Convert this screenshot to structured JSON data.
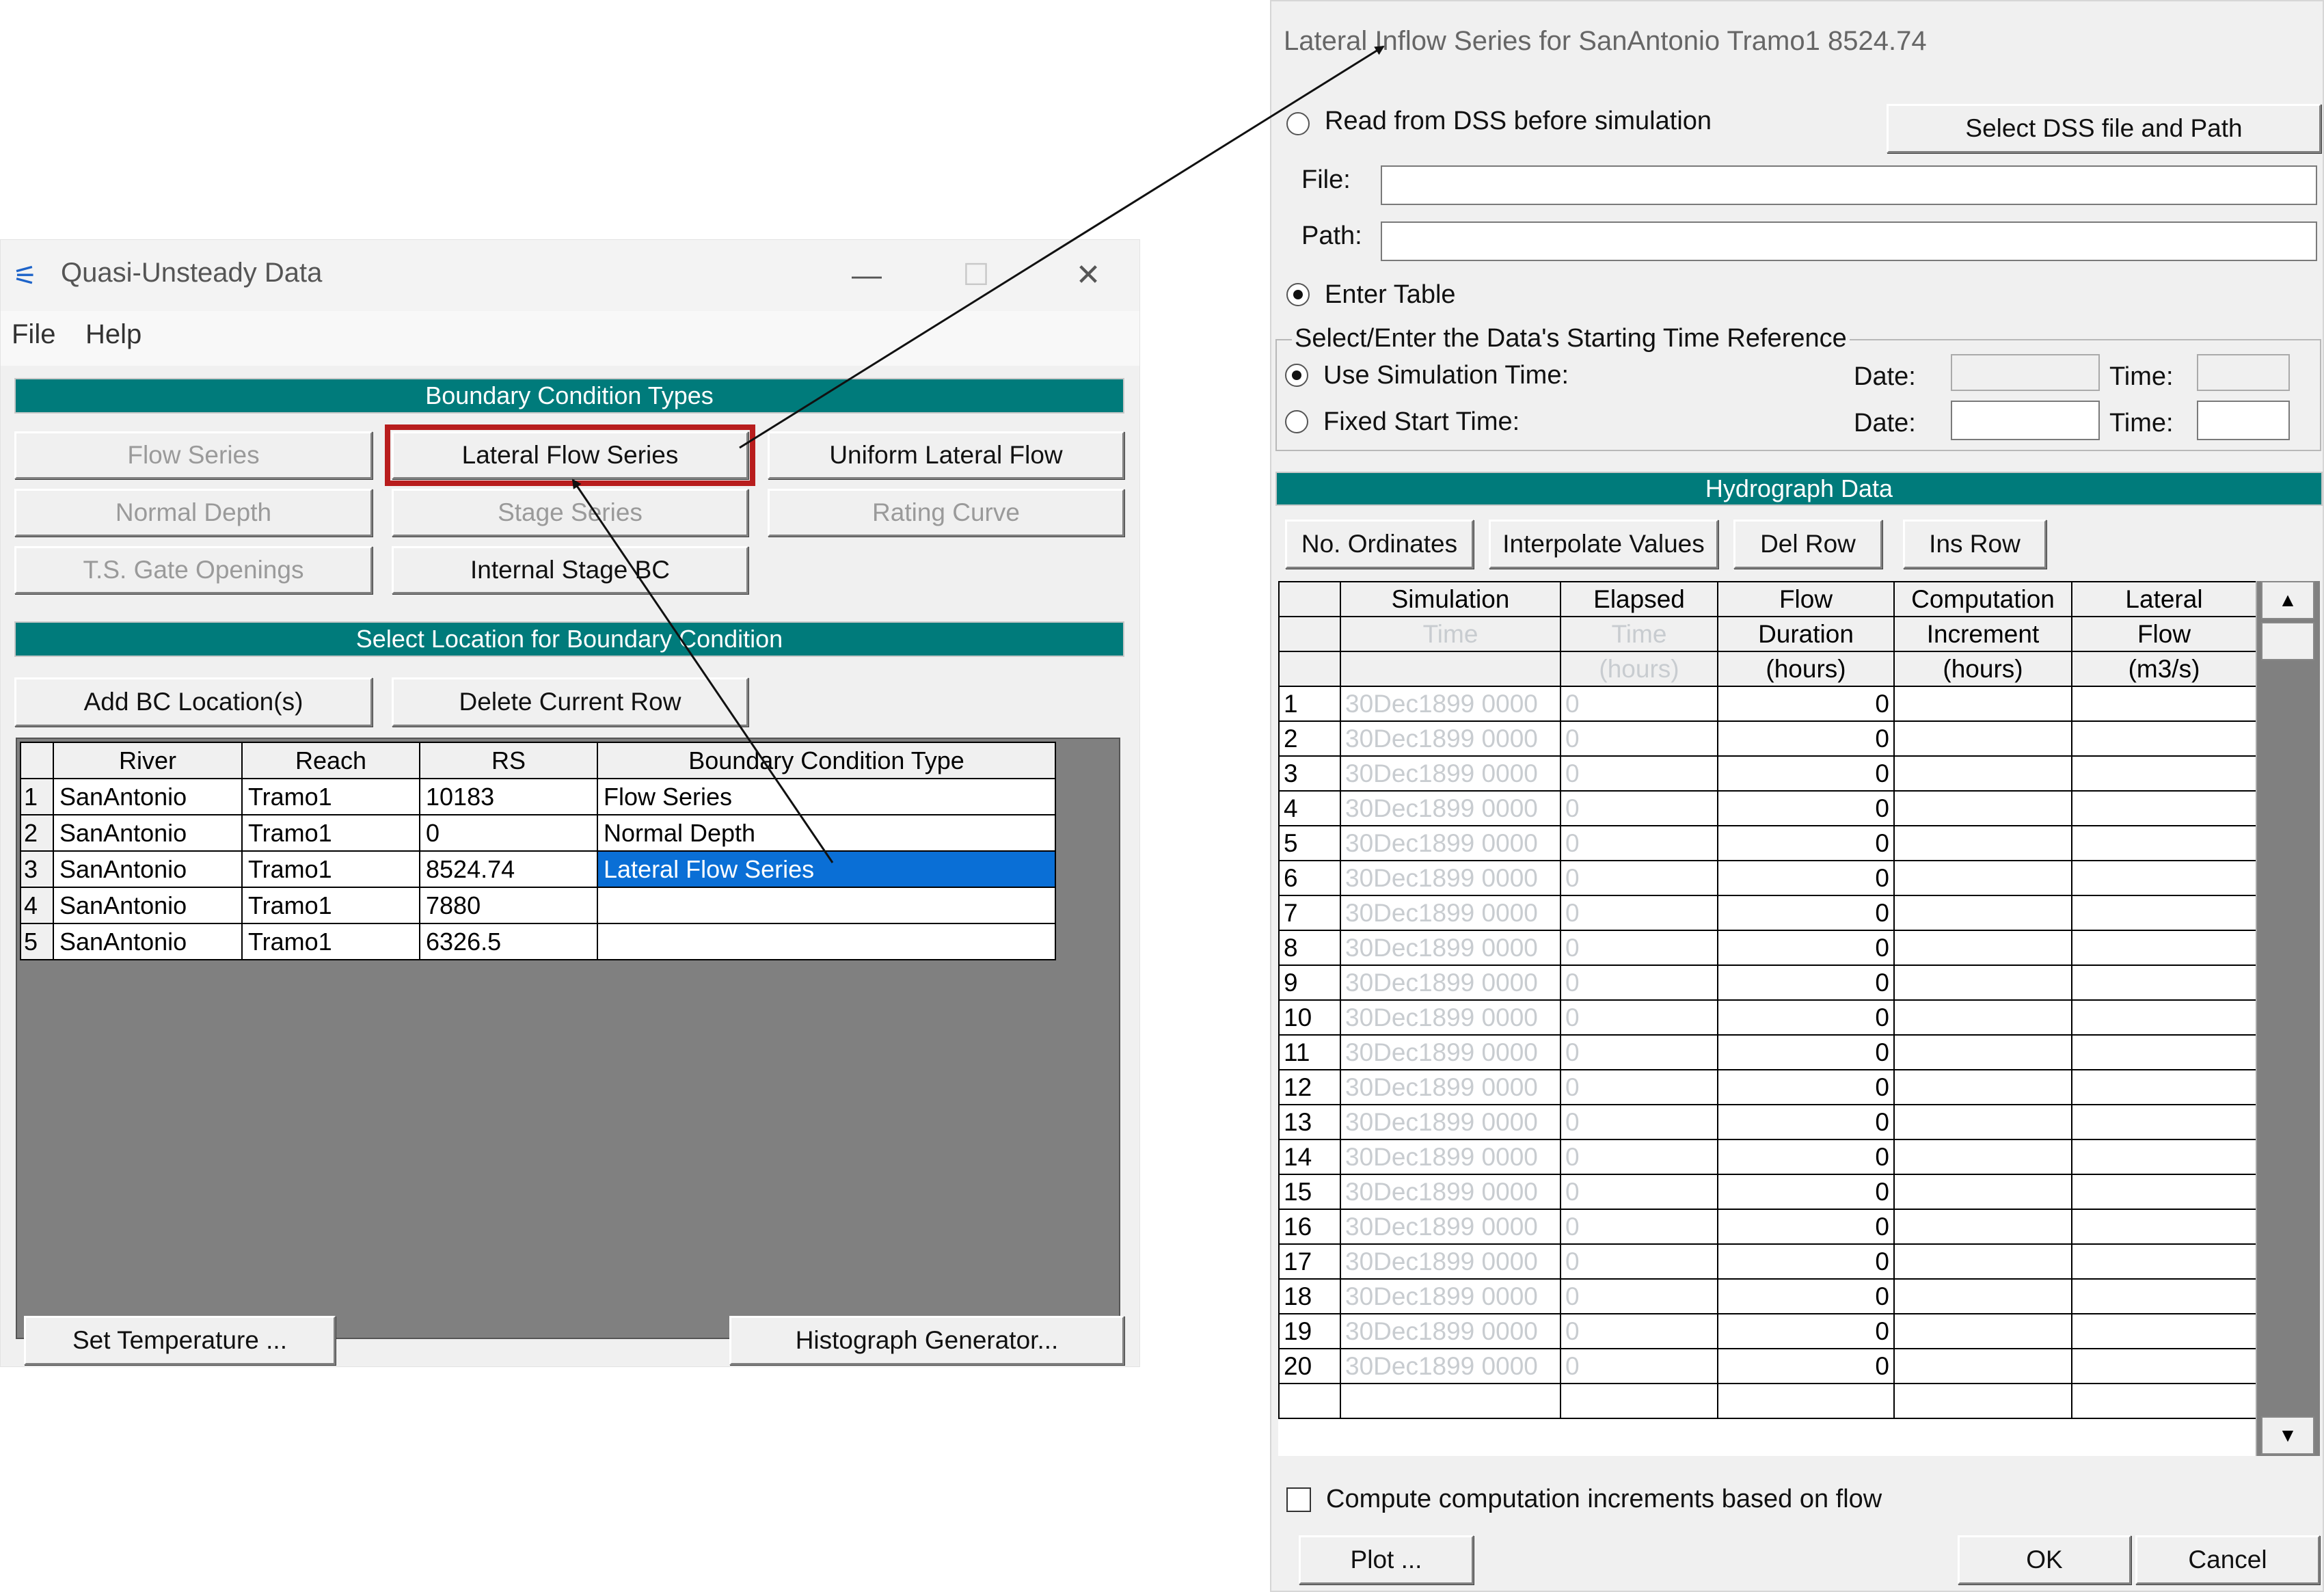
{
  "quasi": {
    "title": "Quasi-Unsteady Data",
    "menu": [
      "File",
      "Help"
    ],
    "bc_types_header": "Boundary Condition Types",
    "bc_buttons": [
      {
        "label": "Flow Series",
        "enabled": false
      },
      {
        "label": "Lateral Flow Series",
        "enabled": true,
        "highlighted": true
      },
      {
        "label": "Uniform Lateral Flow",
        "enabled": true
      },
      {
        "label": "Normal Depth",
        "enabled": false
      },
      {
        "label": "Stage Series",
        "enabled": false
      },
      {
        "label": "Rating Curve",
        "enabled": false
      },
      {
        "label": "T.S. Gate Openings",
        "enabled": false
      },
      {
        "label": "Internal Stage BC",
        "enabled": true
      }
    ],
    "location_header": "Select Location for Boundary Condition",
    "add_bc_label": "Add BC Location(s)",
    "delete_row_label": "Delete Current Row",
    "table": {
      "columns": [
        "River",
        "Reach",
        "RS",
        "Boundary Condition Type"
      ],
      "rows": [
        [
          "1",
          "SanAntonio",
          "Tramo1",
          "10183",
          "Flow Series"
        ],
        [
          "2",
          "SanAntonio",
          "Tramo1",
          "0",
          "Normal Depth"
        ],
        [
          "3",
          "SanAntonio",
          "Tramo1",
          "8524.74",
          "Lateral Flow Series"
        ],
        [
          "4",
          "SanAntonio",
          "Tramo1",
          "7880",
          ""
        ],
        [
          "5",
          "SanAntonio",
          "Tramo1",
          "6326.5",
          ""
        ]
      ]
    },
    "set_temperature_label": "Set Temperature ...",
    "histograph_label": "Histograph Generator..."
  },
  "lateral": {
    "title": "Lateral Inflow Series for SanAntonio Tramo1 8524.74",
    "read_dss_label": "Read from DSS before simulation",
    "select_dss_label": "Select DSS file and Path",
    "file_label": "File:",
    "path_label": "Path:",
    "enter_table_label": "Enter Table",
    "time_ref_legend": "Select/Enter the Data's Starting Time Reference",
    "use_sim_time_label": "Use Simulation Time:",
    "fixed_start_label": "Fixed Start Time:",
    "date_label": "Date:",
    "time_label": "Time:",
    "hydro_header": "Hydrograph Data",
    "toolbar": [
      "No. Ordinates",
      "Interpolate Values",
      "Del Row",
      "Ins Row"
    ],
    "headers_row1": [
      "Simulation",
      "Elapsed",
      "Flow",
      "Computation",
      "Lateral"
    ],
    "headers_row2": [
      "Time",
      "Time",
      "Duration",
      "Increment",
      "Flow"
    ],
    "headers_row3": [
      "",
      "(hours)",
      "(hours)",
      "(hours)",
      "(m3/s)"
    ],
    "sim_time_value": "30Dec1899 0000",
    "elapsed_value": "0",
    "duration_value": "0",
    "row_count": 20,
    "compute_increments_label": "Compute computation increments based on flow",
    "plot_label": "Plot ...",
    "ok_label": "OK",
    "cancel_label": "Cancel"
  },
  "colors": {
    "section_bar": "#007b7b",
    "selected_row": "#0a6fd6",
    "highlight_box": "#b81d1d"
  }
}
